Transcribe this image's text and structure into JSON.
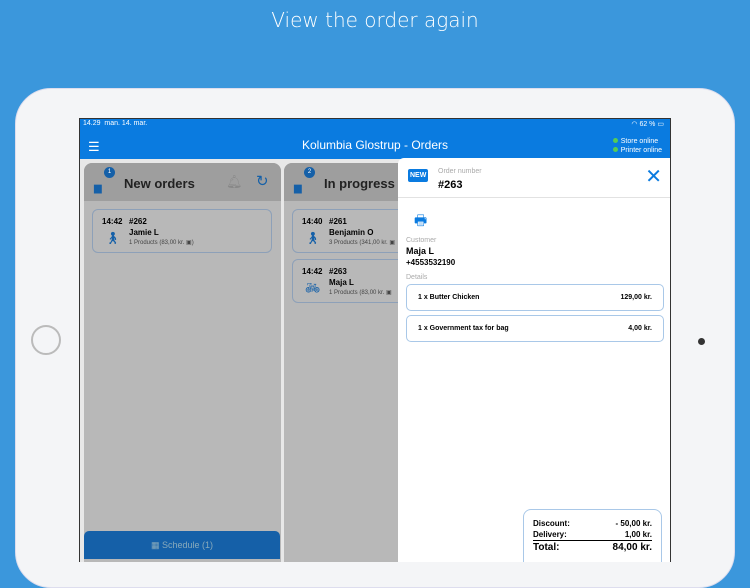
{
  "headline": "View the order again",
  "status": {
    "time": "14.29",
    "date": "man. 14. mar.",
    "battery": "62 %"
  },
  "topbar": {
    "title": "Kolumbia Glostrup - Orders",
    "store": "Store online",
    "printer": "Printer online"
  },
  "columns": [
    {
      "title": "New orders",
      "badge": "1",
      "orders": [
        {
          "time": "14:42",
          "number": "#262",
          "customer": "Jamie L",
          "products": "1 Products (83,00 kr. ▣)"
        }
      ]
    },
    {
      "title": "In progress",
      "badge": "2",
      "orders": [
        {
          "time": "14:40",
          "number": "#261",
          "customer": "Benjamin O",
          "products": "3 Products (341,00 kr. ▣"
        },
        {
          "time": "14:42",
          "number": "#263",
          "customer": "Maja L",
          "products": "1 Products (83,00 kr. ▣"
        }
      ]
    }
  ],
  "schedule": "Schedule (1)",
  "detail": {
    "tag": "NEW",
    "order_label": "Order number",
    "order_number": "#263",
    "customer_label": "Customer",
    "customer_name": "Maja L",
    "phone": "+4553532190",
    "details_label": "Details",
    "items": [
      {
        "name": "1 x Butter Chicken",
        "price": "129,00 kr."
      },
      {
        "name": "1 x Government tax for bag",
        "price": "4,00 kr."
      }
    ],
    "discount_label": "Discount:",
    "discount": "- 50,00 kr.",
    "delivery_label": "Delivery:",
    "delivery": "1,00 kr.",
    "total_label": "Total:",
    "total": "84,00 kr."
  }
}
